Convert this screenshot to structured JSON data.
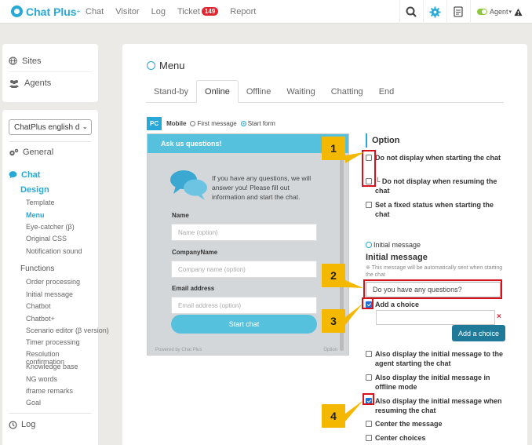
{
  "app": {
    "brand": "Chat Plus",
    "brand_mark": "+"
  },
  "topnav": [
    {
      "label": "Chat"
    },
    {
      "label": "Visitor"
    },
    {
      "label": "Log"
    },
    {
      "label": "Ticket",
      "badge": "149"
    },
    {
      "label": "Report"
    }
  ],
  "agent": {
    "label": "Agent"
  },
  "sidebar_top": [
    {
      "label": "Sites",
      "icon": "globe-icon"
    },
    {
      "label": "Agents",
      "icon": "users-icon"
    }
  ],
  "site_select": {
    "value": "ChatPlus english d"
  },
  "nav": {
    "general": "General",
    "chat": "Chat",
    "design": "Design",
    "design_items": [
      "Template",
      "Menu",
      "Eye-catcher (β)",
      "Original CSS",
      "Notification sound"
    ],
    "functions": "Functions",
    "function_items": [
      "Order processing",
      "Initial message",
      "Chatbot",
      "Chatbot+",
      "Scenario editor (β version)",
      "Timer processing",
      "Resolution confirmation",
      "Knowledge base",
      "NG words",
      "iframe remarks",
      "Goal"
    ],
    "log": "Log",
    "active_item": "Menu"
  },
  "main": {
    "title": "Menu",
    "tabs": [
      "Stand-by",
      "Online",
      "Offline",
      "Waiting",
      "Chatting",
      "End"
    ],
    "active_tab": "Online",
    "pc_badge": "PC",
    "mobile_label": "Mobile",
    "radio_first": "First message",
    "radio_start": "Start form"
  },
  "preview": {
    "header": "Ask us questions!",
    "message": "If you have any questions, we will answer you! Please fill out information and start the chat.",
    "fields": [
      {
        "label": "Name",
        "placeholder": "Name (option)"
      },
      {
        "label": "CompanyName",
        "placeholder": "Company name (option)"
      },
      {
        "label": "Email address",
        "placeholder": "Email address (option)"
      }
    ],
    "button": "Start chat",
    "footer": "Powered by Chat Plus",
    "option": "Option"
  },
  "options": {
    "title": "Option",
    "checkbox_1": "Do not display when starting the chat",
    "checkbox_2": "└ Do not display when resuming the chat",
    "checkbox_3": "Set a fixed status when starting the chat",
    "sub_initial": "Initial message",
    "initial_heading": "Initial message",
    "initial_note": "※ This message will be automatically sent when starting the chat",
    "initial_value": "Do you have any questions?",
    "add_choice_check": "Add a choice",
    "add_choice_btn": "Add a choice",
    "remove": "×",
    "extra_1": "Also display the initial message to the agent starting the chat",
    "extra_2": "Also display the initial message in offline mode",
    "extra_3": "Also display the initial message when resuming the chat",
    "extra_4": "Center the message",
    "extra_5": "Center choices"
  },
  "callouts": [
    "1",
    "2",
    "3",
    "4"
  ],
  "colors": {
    "accent": "#28a8d6",
    "badge": "#e0272f",
    "callout": "#f5b800",
    "highlight": "#d8121c"
  }
}
